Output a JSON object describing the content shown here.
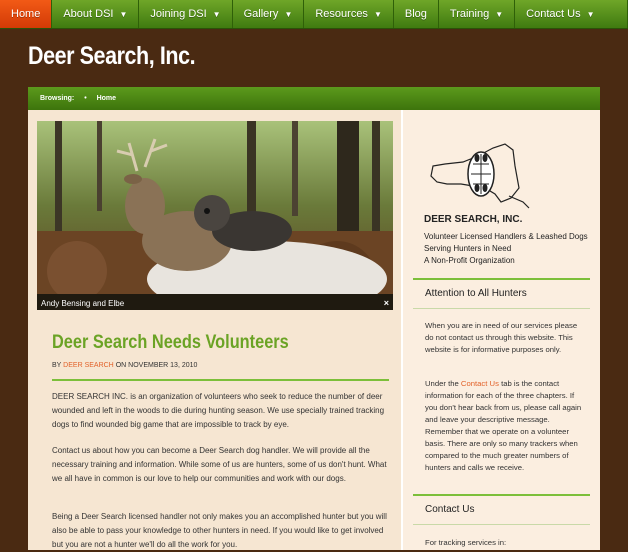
{
  "nav": {
    "items": [
      {
        "label": "Home",
        "active": true,
        "dropdown": false
      },
      {
        "label": "About DSI",
        "active": false,
        "dropdown": true
      },
      {
        "label": "Joining DSI",
        "active": false,
        "dropdown": true
      },
      {
        "label": "Gallery",
        "active": false,
        "dropdown": true
      },
      {
        "label": "Resources",
        "active": false,
        "dropdown": true
      },
      {
        "label": "Blog",
        "active": false,
        "dropdown": false
      },
      {
        "label": "Training",
        "active": false,
        "dropdown": true
      },
      {
        "label": "Contact Us",
        "active": false,
        "dropdown": true
      }
    ],
    "caret": "▼"
  },
  "site": {
    "title": "Deer Search, Inc."
  },
  "breadcrumb": {
    "prefix": "Browsing:",
    "separator": "•",
    "current": "Home"
  },
  "feature": {
    "caption": "Andy Bensing and Elbe",
    "close": "×"
  },
  "post": {
    "title": "Deer Search Needs Volunteers",
    "by": "BY",
    "author": "DEER SEARCH",
    "on": "ON NOVEMBER 13, 2010",
    "paragraphs": [
      "DEER SEARCH INC. is an organization of volunteers who seek to reduce the number of deer wounded and left in the woods to die during hunting season. We use specially trained tracking dogs to find wounded big game that are impossible to track by eye.",
      "Contact us about how you can become a Deer Search dog handler. We will provide all the necessary training and information. While some of us are hunters, some of us don't hunt. What we all have in common is our love to help our communities and work with our dogs.",
      "Being a Deer Search licensed handler not only makes you an accomplished hunter but you will also be able to pass your knowledge to other hunters in need. If you would like to get involved but you are not a hunter we'll do all the work for you."
    ]
  },
  "sidebar": {
    "logo": {
      "name": "DEER SEARCH, INC.",
      "tagline": "Volunteer Licensed Handlers & Leashed Dogs Serving Hunters in Need",
      "subtag": "A Non-Profit Organization"
    },
    "attention": {
      "heading": "Attention to All Hunters",
      "p1": "When you are in need of our services please do not contact us through this website. This website is for informative purposes only.",
      "p2_before": "Under the ",
      "p2_link": "Contact Us",
      "p2_after": " tab is the contact information for each of the three chapters. If you don't hear back from us, please call again and leave your descriptive message. Remember that we operate on a volunteer basis. There are only so many trackers when compared to the much greater numbers of hunters and calls we receive."
    },
    "contact": {
      "heading": "Contact Us",
      "text": "For tracking services in:"
    }
  },
  "colors": {
    "nav_green": "#4f8c18",
    "active_orange": "#e84a10",
    "accent_green": "#6ba325",
    "link_orange": "#e2622a",
    "background_brown": "#4a2a12"
  }
}
